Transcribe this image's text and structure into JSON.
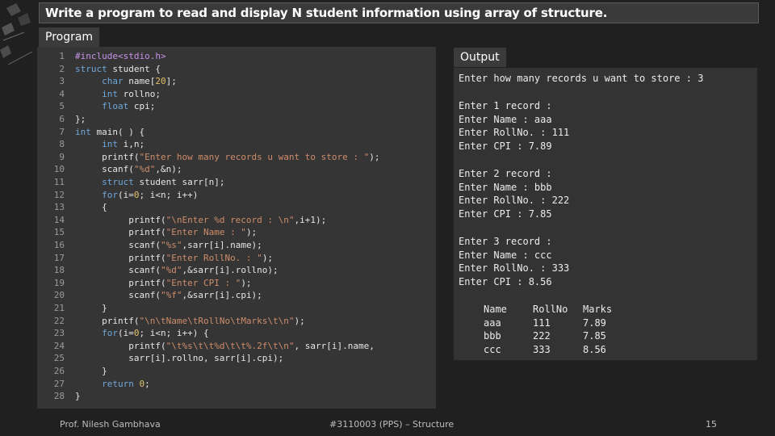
{
  "slide": {
    "title": "Write a program to read and display N student information using array of structure.",
    "program_tab": "Program",
    "output_tab": "Output"
  },
  "code": [
    {
      "n": "1",
      "t": "#include<stdio.h>"
    },
    {
      "n": "2",
      "t": "struct student {"
    },
    {
      "n": "3",
      "t": "     char name[20];"
    },
    {
      "n": "4",
      "t": "     int rollno;"
    },
    {
      "n": "5",
      "t": "     float cpi;"
    },
    {
      "n": "6",
      "t": "};"
    },
    {
      "n": "7",
      "t": "int main( ) {"
    },
    {
      "n": "8",
      "t": "     int i,n;"
    },
    {
      "n": "9",
      "t": "     printf(\"Enter how many records u want to store : \");"
    },
    {
      "n": "10",
      "t": "     scanf(\"%d\",&n);"
    },
    {
      "n": "11",
      "t": "     struct student sarr[n];"
    },
    {
      "n": "12",
      "t": "     for(i=0; i<n; i++)"
    },
    {
      "n": "13",
      "t": "     {"
    },
    {
      "n": "14",
      "t": "          printf(\"\\nEnter %d record : \\n\",i+1);"
    },
    {
      "n": "15",
      "t": "          printf(\"Enter Name : \");"
    },
    {
      "n": "16",
      "t": "          scanf(\"%s\",sarr[i].name);"
    },
    {
      "n": "17",
      "t": "          printf(\"Enter RollNo. : \");"
    },
    {
      "n": "18",
      "t": "          scanf(\"%d\",&sarr[i].rollno);"
    },
    {
      "n": "19",
      "t": "          printf(\"Enter CPI : \");"
    },
    {
      "n": "20",
      "t": "          scanf(\"%f\",&sarr[i].cpi);"
    },
    {
      "n": "21",
      "t": "     }"
    },
    {
      "n": "22",
      "t": "     printf(\"\\n\\tName\\tRollNo\\tMarks\\t\\n\");"
    },
    {
      "n": "23",
      "t": "     for(i=0; i<n; i++) {"
    },
    {
      "n": "24",
      "t": "          printf(\"\\t%s\\t\\t%d\\t\\t%.2f\\t\\n\", sarr[i].name,"
    },
    {
      "n": "25",
      "t": "          sarr[i].rollno, sarr[i].cpi);"
    },
    {
      "n": "26",
      "t": "     }"
    },
    {
      "n": "27",
      "t": "     return 0;"
    },
    {
      "n": "28",
      "t": "}"
    }
  ],
  "output": [
    "Enter how many records u want to store : 3",
    "Enter 1 record :",
    "Enter Name : aaa",
    "Enter RollNo. : 111",
    "Enter CPI : 7.89",
    "Enter 2 record :",
    "Enter Name : bbb",
    "Enter RollNo. : 222",
    "Enter CPI : 7.85",
    "Enter 3 record :",
    "Enter Name : ccc",
    "Enter RollNo. : 333",
    "Enter CPI : 8.56"
  ],
  "output_table": {
    "headers": [
      "Name",
      "RollNo",
      "Marks"
    ],
    "rows": [
      [
        "aaa",
        "111",
        "7.89"
      ],
      [
        "bbb",
        "222",
        "7.85"
      ],
      [
        "ccc",
        "333",
        "8.56"
      ]
    ]
  },
  "footer": {
    "author": "Prof. Nilesh Gambhava",
    "course": "#3110003 (PPS) – Structure",
    "page": "15"
  },
  "colors": {
    "background": "#202020",
    "panel": "#353535",
    "keyword": "#6fa8dc",
    "string": "#ce8c6a",
    "number": "#e3c26c",
    "preprocessor": "#c792ea"
  }
}
